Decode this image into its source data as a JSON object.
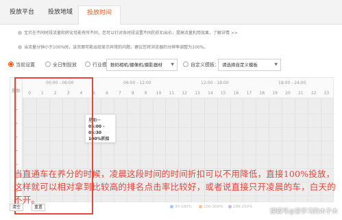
{
  "tabs": [
    {
      "label": "投放平台"
    },
    {
      "label": "投放地域"
    },
    {
      "label": "投放时间"
    }
  ],
  "tips": [
    "宝贝在不同时段流量和转化可能有所不同，您可以针对各时段设置不同的折扣出价，提高流量利用效果，了解详情 >>",
    "当流量分钟小于100%时，该页面可能出现显示异常的问题，建议您将浏览器的分辨率调整为100%。"
  ],
  "options": {
    "current": "当前设置",
    "all_day": "全日制投放",
    "industry": "行业模板：",
    "industry_select": "数码相机/摄像机/摄影器材",
    "custom": "自定义模板：",
    "custom_select": "请选择自定义模板",
    "active_color": "#ff5000"
  },
  "grid": {
    "ranges": [
      "00:00 - 06:00",
      "06:00 - 12:00",
      "12:00 - 18:00",
      "18:00 - 24:00"
    ],
    "hours": [
      "0",
      "1",
      "2",
      "3",
      "4",
      "5",
      "6",
      "7",
      "8",
      "9",
      "10",
      "11",
      "12",
      "13",
      "14",
      "15",
      "16",
      "17",
      "18",
      "19",
      "20",
      "21",
      "22",
      "23"
    ],
    "weekday_label": "星期"
  },
  "tooltip": {
    "day": "星期一",
    "time": "05:00 - 05:30",
    "discount": "100%折扣"
  },
  "caption": "当直通车在养分的时候，凌晨这段时间的时间折扣可以不用降低，直接100%投放，这样就可以相对拿到比较高的排名点击率比较好，或者说直接只开凌晨的车，白天的不开。",
  "buttons": {
    "clear": "清空",
    "reset": "重置"
  },
  "legend": [
    {
      "label": "30-100%",
      "color": "#9ec9ff"
    },
    {
      "label": "100-300%",
      "color": "#ffc38a"
    },
    {
      "label": "200-250%",
      "color": "#d7b2f0"
    }
  ],
  "watermark": "搜狐号@爱学习的木子木",
  "annotation_color": "#e8443a"
}
